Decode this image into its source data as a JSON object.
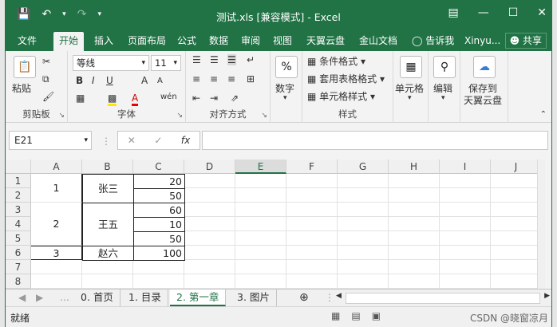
{
  "titlebar": {
    "title": "测试.xls  [兼容模式] - Excel",
    "save_icon": "save-icon",
    "undo_icon": "undo-icon",
    "redo_icon": "redo-icon"
  },
  "tabs": {
    "file": "文件",
    "home": "开始",
    "insert": "插入",
    "layout": "页面布局",
    "formula": "公式",
    "data": "数据",
    "review": "审阅",
    "view": "视图",
    "tianyi": "天翼云盘",
    "jinshan": "金山文档",
    "tellme": "告诉我",
    "user": "Xinyu...",
    "share": "共享"
  },
  "ribbon": {
    "paste": "粘贴",
    "clipboard": "剪贴板",
    "font_name": "等线",
    "font_size": "11",
    "bold": "B",
    "italic": "I",
    "underline": "U",
    "grow": "A",
    "shrink": "A",
    "wen": "wén",
    "font": "字体",
    "align": "对齐方式",
    "number": "数字",
    "percent": "%",
    "cond_format": "条件格式",
    "table_format": "套用表格格式",
    "cell_style": "单元格样式",
    "style": "样式",
    "cells": "单元格",
    "edit": "编辑",
    "save_tianyi": "保存到",
    "save_tianyi2": "天翼云盘"
  },
  "formula_bar": {
    "name_box": "E21",
    "fx": "fx",
    "content": ""
  },
  "sheet": {
    "columns": [
      "A",
      "B",
      "C",
      "D",
      "E",
      "F",
      "G",
      "H",
      "I",
      "J"
    ],
    "rows": [
      "1",
      "2",
      "3",
      "4",
      "5",
      "6",
      "7",
      "8"
    ],
    "selected_col": "E",
    "merged": [
      {
        "ref": "A1:A2",
        "value": "1"
      },
      {
        "ref": "B1:B2",
        "value": "张三"
      },
      {
        "ref": "A3:A5",
        "value": "2"
      },
      {
        "ref": "B3:B5",
        "value": "王五"
      },
      {
        "ref": "A6",
        "value": "3"
      },
      {
        "ref": "B6",
        "value": "赵六"
      }
    ],
    "c_values": [
      "20",
      "50",
      "60",
      "10",
      "50",
      "100"
    ]
  },
  "sheet_tabs": [
    "0. 首页",
    "1. 目录",
    "2. 第一章",
    "3. 图片"
  ],
  "active_sheet": "2. 第一章",
  "status": {
    "ready": "就绪",
    "watermark": "CSDN @晓窗凉月"
  }
}
